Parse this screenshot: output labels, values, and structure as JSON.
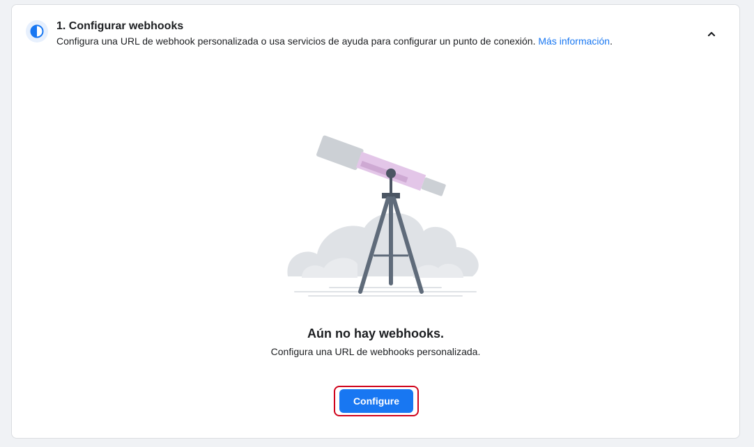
{
  "step": {
    "title": "1. Configurar webhooks",
    "description": "Configura una URL de webhook personalizada o usa servicios de ayuda para configurar un punto de conexión. ",
    "link_text": "Más información",
    "link_suffix": ".",
    "icon": "half-circle-progress-icon",
    "collapse_icon": "chevron-up-icon"
  },
  "empty_state": {
    "illustration": "telescope-illustration",
    "title": "Aún no hay webhooks.",
    "subtitle": "Configura una URL de webhooks personalizada.",
    "button_label": "Configure"
  },
  "colors": {
    "accent": "#1877f2",
    "highlight_outline": "#d0021b"
  }
}
